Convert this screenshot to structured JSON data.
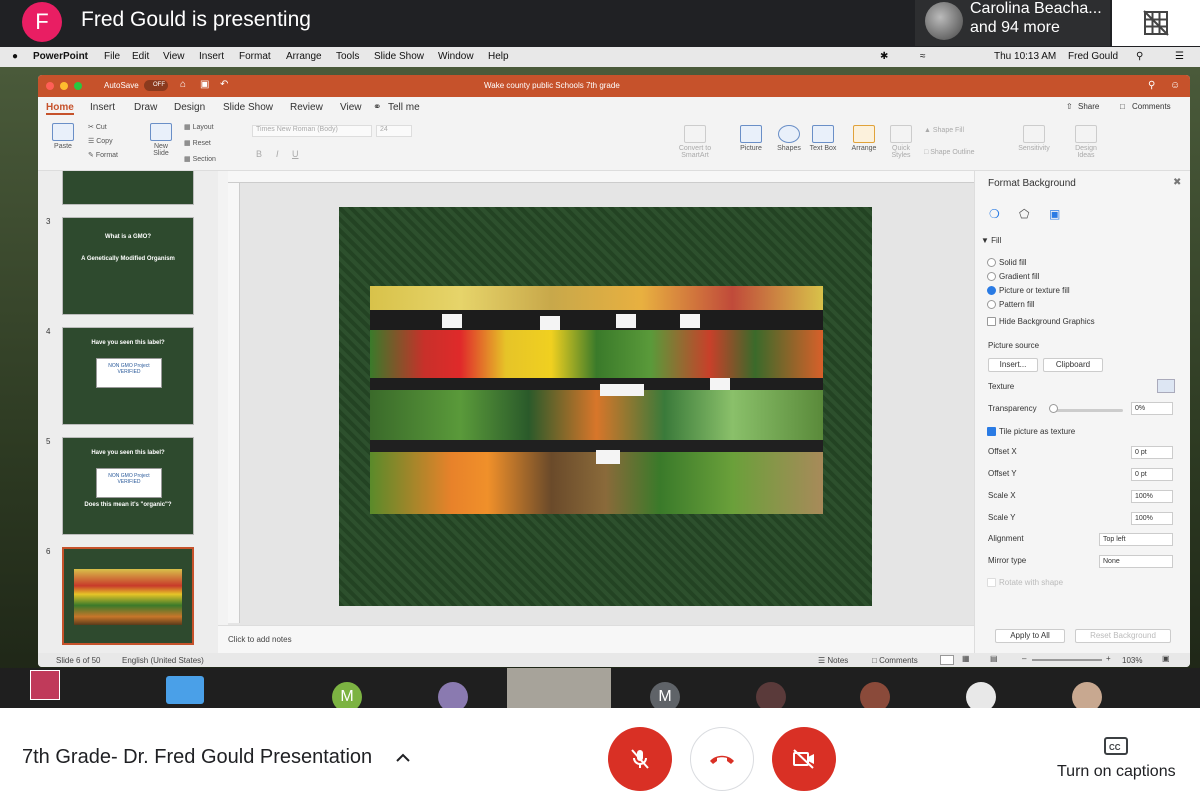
{
  "meet": {
    "presenter_initial": "F",
    "presenting_text": "Fred Gould is presenting",
    "participant_name": "Carolina Beacha...",
    "participant_more": "and 94 more",
    "meeting_title": "7th Grade- Dr. Fred Gould Presentation",
    "captions_label": "Turn on captions",
    "strip_initial_1": "M",
    "strip_initial_2": "M"
  },
  "mac_menu": {
    "items": [
      "PowerPoint",
      "File",
      "Edit",
      "View",
      "Insert",
      "Format",
      "Arrange",
      "Tools",
      "Slide Show",
      "Window",
      "Help"
    ],
    "clock": "Thu 10:13 AM",
    "user": "Fred Gould"
  },
  "ppt": {
    "autosave": "AutoSave",
    "autosave_state": "OFF",
    "doc_title": "Wake county public Schools 7th grade",
    "tabs": [
      "Home",
      "Insert",
      "Draw",
      "Design",
      "Slide Show",
      "Review",
      "View"
    ],
    "tell_me": "Tell me",
    "share": "Share",
    "comments": "Comments",
    "ribbon": {
      "paste": "Paste",
      "cut": "Cut",
      "copy": "Copy",
      "format": "Format",
      "new_slide": "New Slide",
      "layout": "Layout",
      "reset": "Reset",
      "section": "Section",
      "font": "Times New Roman (Body)",
      "size": "24",
      "convert": "Convert to SmartArt",
      "picture": "Picture",
      "shapes": "Shapes",
      "text_box": "Text Box",
      "arrange": "Arrange",
      "quick_styles": "Quick Styles",
      "shape_fill": "Shape Fill",
      "shape_outline": "Shape Outline",
      "sensitivity": "Sensitivity",
      "design_ideas": "Design Ideas"
    },
    "thumbs": [
      {
        "num": "3",
        "line1": "What is a GMO?",
        "line2": "A Genetically Modified Organism"
      },
      {
        "num": "4",
        "line1": "Have you seen this label?",
        "line2": ""
      },
      {
        "num": "5",
        "line1": "Have you seen this label?",
        "line2": "Does this mean it's \"organic\"?"
      },
      {
        "num": "6",
        "line1": "",
        "line2": ""
      }
    ],
    "badge_text": "NON GMO Project VERIFIED",
    "notes": "Click to add notes",
    "status": {
      "slide": "Slide 6 of 50",
      "lang": "English (United States)",
      "notes": "Notes",
      "comments": "Comments",
      "zoom": "103%"
    },
    "format_bg": {
      "title": "Format Background",
      "fill": "Fill",
      "solid": "Solid fill",
      "gradient": "Gradient fill",
      "picture": "Picture or texture fill",
      "pattern": "Pattern fill",
      "hide": "Hide Background Graphics",
      "source": "Picture source",
      "insert": "Insert...",
      "clipboard": "Clipboard",
      "texture": "Texture",
      "transparency": "Transparency",
      "transparency_val": "0%",
      "tile": "Tile picture as texture",
      "offset_x": "Offset X",
      "offset_x_val": "0 pt",
      "offset_y": "Offset Y",
      "offset_y_val": "0 pt",
      "scale_x": "Scale X",
      "scale_x_val": "100%",
      "scale_y": "Scale Y",
      "scale_y_val": "100%",
      "alignment": "Alignment",
      "alignment_val": "Top left",
      "mirror": "Mirror type",
      "mirror_val": "None",
      "rotate": "Rotate with shape",
      "apply_all": "Apply to All",
      "reset_bg": "Reset Background"
    }
  },
  "colors": {
    "presenter_avatar": "#e91e63",
    "ppt_title": "#c6522b",
    "end_call": "#ffffff",
    "mute_red": "#d93025"
  }
}
